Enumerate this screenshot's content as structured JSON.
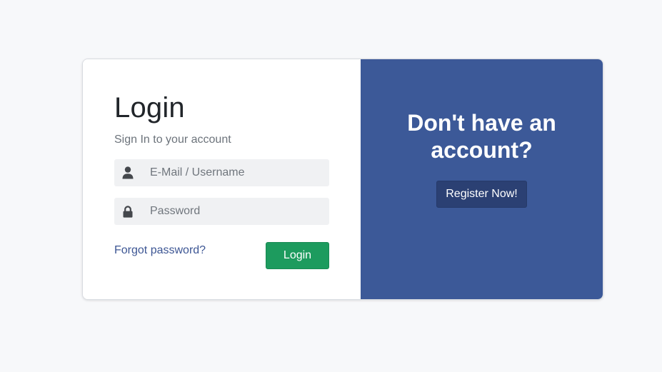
{
  "login": {
    "title": "Login",
    "subtitle": "Sign In to your account",
    "username_placeholder": "E-Mail / Username",
    "username_value": "",
    "password_placeholder": "Password",
    "password_value": "",
    "forgot_label": "Forgot password?",
    "login_button_label": "Login",
    "icons": {
      "username": "user-icon",
      "password": "lock-icon"
    }
  },
  "register": {
    "heading": "Don't have an account?",
    "button_label": "Register Now!"
  },
  "colors": {
    "page_background": "#f7f8fa",
    "panel_accent": "#3c5998",
    "register_button": "#2b4073",
    "login_button": "#1d9b5e",
    "link": "#3d5694"
  }
}
